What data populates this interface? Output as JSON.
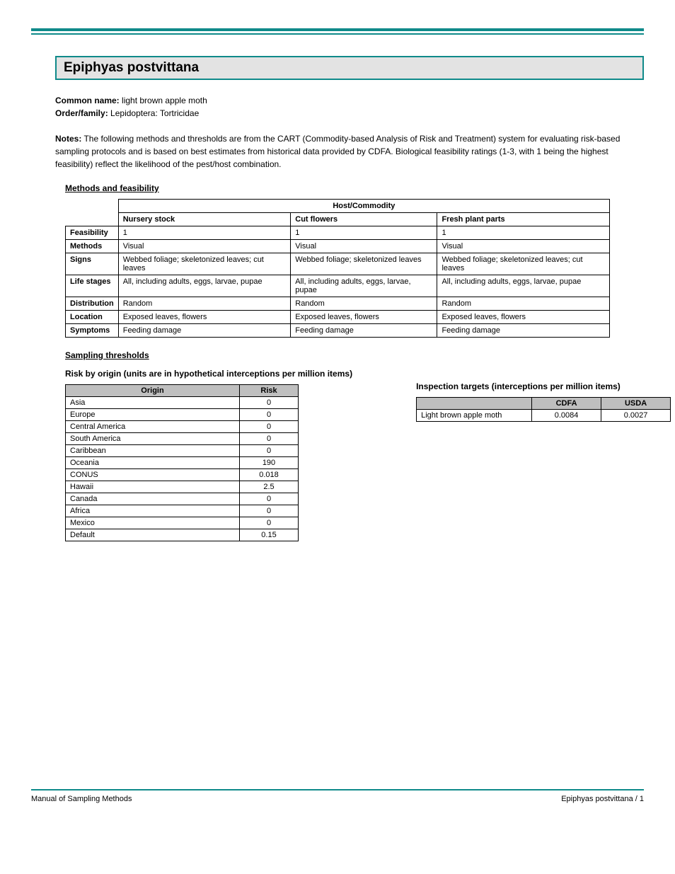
{
  "footer": {
    "left": "Manual of Sampling Methods",
    "right": "Epiphyas postvittana / 1"
  },
  "title": "Epiphyas postvittana",
  "intro": {
    "common": "light brown apple moth",
    "order": "Lepidoptera",
    "family": "Tortricidae",
    "note": "The following methods and thresholds are from the CART (Commodity-based Analysis of Risk and Treatment) system for evaluating risk-based sampling protocols and is based on best estimates from historical data provided by CDFA. Biological feasibility ratings (1-3, with 1 being the highest feasibility) reflect the likelihood of the pest/host combination.",
    "meth_label": "Methods and feasibility"
  },
  "t1": {
    "top": "Host/Commodity",
    "cols": [
      "Nursery stock",
      "Cut flowers",
      "Fresh plant parts"
    ],
    "rows": [
      {
        "label": "Feasibility",
        "v": [
          "1",
          "1",
          "1"
        ]
      },
      {
        "label": "Methods",
        "v": [
          "Visual",
          "Visual",
          "Visual"
        ]
      },
      {
        "label": "Signs",
        "v": [
          "Webbed foliage; skeletonized leaves; cut leaves",
          "Webbed foliage; skeletonized leaves",
          "Webbed foliage; skeletonized leaves; cut leaves"
        ]
      },
      {
        "label": "Life stages",
        "v": [
          "All, including adults, eggs, larvae, pupae",
          "All, including adults, eggs, larvae, pupae",
          "All, including adults, eggs, larvae, pupae"
        ]
      },
      {
        "label": "Distribution",
        "v": [
          "Random",
          "Random",
          "Random"
        ]
      },
      {
        "label": "Location",
        "v": [
          "Exposed leaves, flowers",
          "Exposed leaves, flowers",
          "Exposed leaves, flowers"
        ]
      },
      {
        "label": "Symptoms",
        "v": [
          "Feeding damage",
          "Feeding damage",
          "Feeding damage"
        ]
      }
    ]
  },
  "section2": "Sampling thresholds",
  "col1": {
    "title": "Risk by origin (units are in hypothetical interceptions per million items)",
    "headers": [
      "Origin",
      "Risk"
    ],
    "rows": [
      [
        "Asia",
        "0"
      ],
      [
        "Europe",
        "0"
      ],
      [
        "Central America",
        "0"
      ],
      [
        "South America",
        "0"
      ],
      [
        "Caribbean",
        "0"
      ],
      [
        "Oceania",
        "190"
      ],
      [
        "CONUS",
        "0.018"
      ],
      [
        "Hawaii",
        "2.5"
      ],
      [
        "Canada",
        "0"
      ],
      [
        "Africa",
        "0"
      ],
      [
        "Mexico",
        "0"
      ],
      [
        "Default",
        "0.15"
      ]
    ]
  },
  "col2": {
    "title": "Inspection targets (interceptions per million items)",
    "headers": [
      "",
      "CDFA",
      "USDA"
    ],
    "row": [
      "Light brown apple moth",
      "0.0084",
      "0.0027"
    ]
  }
}
